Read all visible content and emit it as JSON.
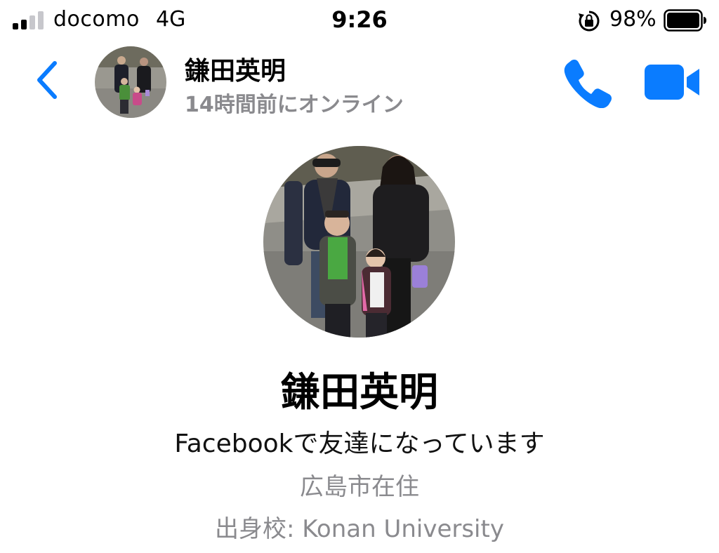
{
  "status_bar": {
    "carrier": "docomo",
    "network": "4G",
    "time": "9:26",
    "battery_percent": "98%",
    "signal_bars_filled": 2,
    "signal_bars_total": 4,
    "icons": {
      "signal": "cellular-signal-icon",
      "lock": "orientation-lock-icon",
      "battery": "battery-icon"
    }
  },
  "header": {
    "contact_name": "鎌田英明",
    "last_online": "14時間前にオンライン",
    "icons": {
      "back": "chevron-left-icon",
      "call": "phone-icon",
      "video": "video-camera-icon"
    }
  },
  "profile": {
    "name": "鎌田英明",
    "friend_status": "Facebookで友達になっています",
    "residence": "広島市在住",
    "school_label": "出身校: ",
    "school_name": "Konan University"
  },
  "colors": {
    "accent": "#0a7cff",
    "secondary_text": "#8a8a8e",
    "primary_text": "#000000",
    "background": "#ffffff"
  }
}
